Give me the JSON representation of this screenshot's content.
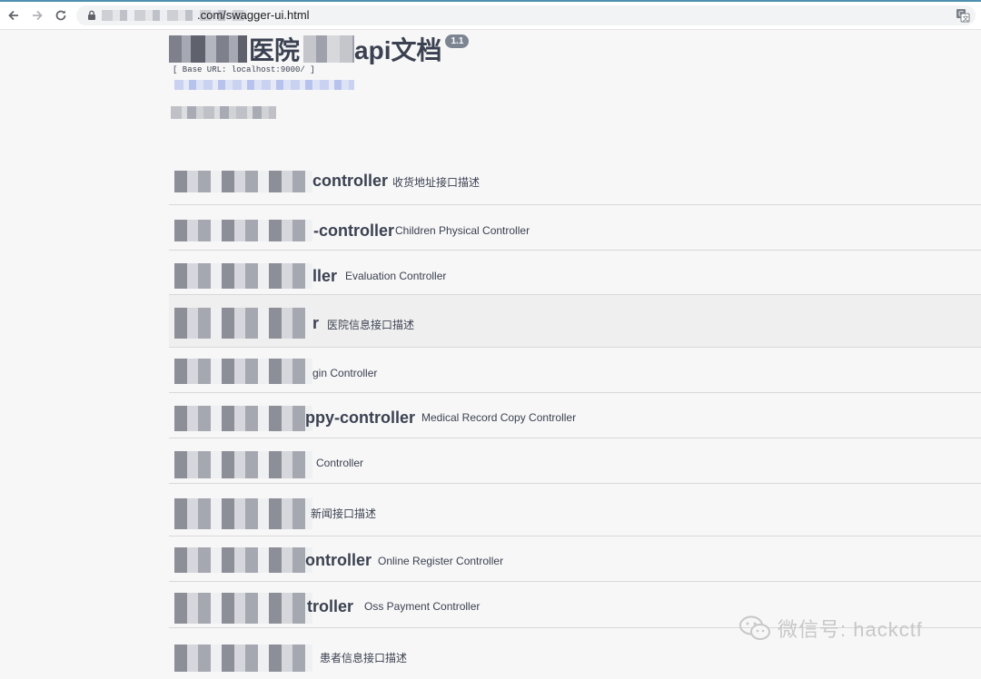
{
  "browser": {
    "url_text": ".com/swagger-ui.html"
  },
  "header": {
    "title_part1": "医院",
    "title_part2": "api文档",
    "version": "1.1",
    "base_url": "[ Base URL: localhost:9000/ ]"
  },
  "controllers": [
    {
      "name": "controller",
      "desc": "收货地址接口描述"
    },
    {
      "name": "-controller",
      "desc": "Children Physical Controller"
    },
    {
      "name": "ller",
      "desc": "Evaluation Controller"
    },
    {
      "name": "r",
      "desc": "医院信息接口描述"
    },
    {
      "name": "",
      "desc": "gin Controller"
    },
    {
      "name": "ppy-controller",
      "desc": "Medical Record Copy Controller"
    },
    {
      "name": "",
      "desc": "Controller"
    },
    {
      "name": "",
      "desc": "新闻接口描述"
    },
    {
      "name": "ontroller",
      "desc": "Online Register Controller"
    },
    {
      "name": "troller",
      "desc": "Oss Payment Controller"
    },
    {
      "name": "",
      "desc": "患者信息接口描述"
    }
  ],
  "watermark": {
    "text": "微信号: hackctf"
  },
  "colors": {
    "text": "#3b4151",
    "version_badge": "#7d8492",
    "background": "#f7f7f7"
  }
}
